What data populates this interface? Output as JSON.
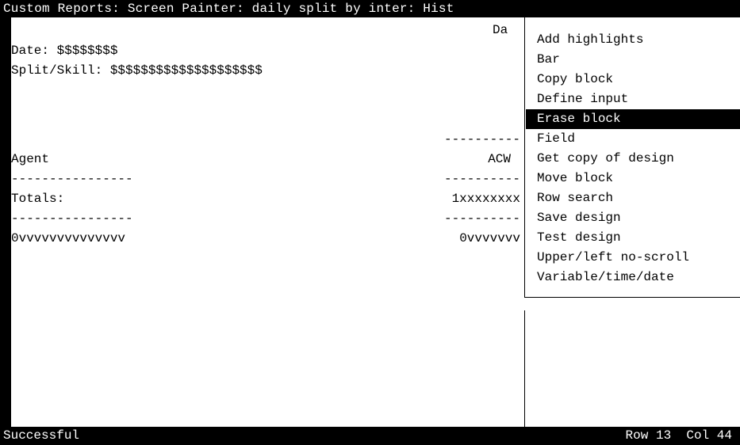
{
  "title": "Custom Reports: Screen Painter: daily split by inter: Hist",
  "report": {
    "top_right_text": "Da",
    "date_line": "Date: $$$$$$$$",
    "split_line": "Split/Skill: $$$$$$$$$$$$$$$$$$$$",
    "header_dashes": "----------",
    "agent_label": "Agent",
    "acw_label": "ACW",
    "dash_left_1": "----------------",
    "dash_right_1": "----------",
    "totals_label": "Totals:",
    "totals_value": "1xxxxxxxx",
    "dash_left_2": "----------------",
    "dash_right_2": "----------",
    "row_left": "0vvvvvvvvvvvvvv",
    "row_right": "0vvvvvvv"
  },
  "menu": {
    "items": [
      "Add highlights",
      "Bar",
      "Copy block",
      "Define input",
      "Erase block",
      "Field",
      "Get copy of design",
      "Move block",
      "Row search",
      "Save design",
      "Test design",
      "Upper/left no-scroll",
      "Variable/time/date"
    ],
    "selected_index": 4
  },
  "status": {
    "message": "Successful",
    "row_label": "Row",
    "row_value": "13",
    "col_label": "Col",
    "col_value": "44"
  }
}
